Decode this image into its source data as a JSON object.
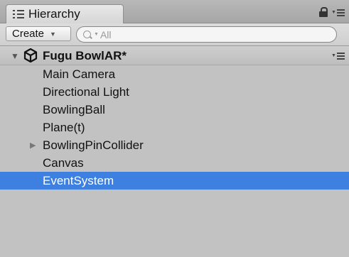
{
  "tab": {
    "title": "Hierarchy"
  },
  "toolbar": {
    "create_label": "Create",
    "search_placeholder": "All"
  },
  "scene": {
    "name": "Fugu BowlAR*"
  },
  "items": [
    {
      "label": "Main Camera"
    },
    {
      "label": "Directional Light"
    },
    {
      "label": "BowlingBall"
    },
    {
      "label": "Plane(t)"
    },
    {
      "label": "BowlingPinCollider",
      "expandable": true
    },
    {
      "label": "Canvas"
    },
    {
      "label": "EventSystem",
      "selected": true
    }
  ],
  "colors": {
    "selection": "#3d80df",
    "panel_bg": "#c2c2c2"
  }
}
